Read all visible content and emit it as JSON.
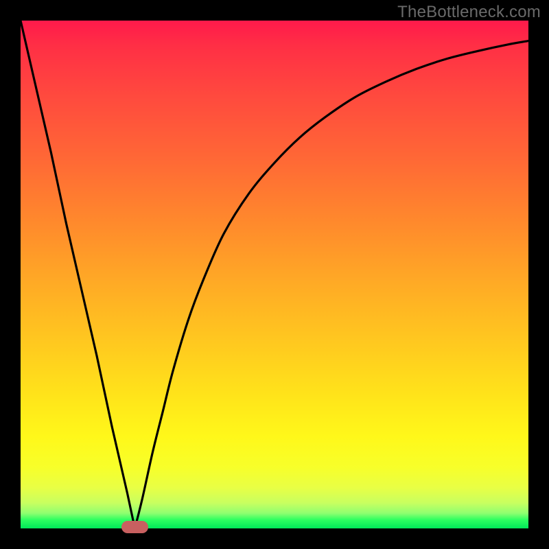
{
  "watermark": "TheBottleneck.com",
  "chart_data": {
    "type": "line",
    "title": "",
    "xlabel": "",
    "ylabel": "",
    "xlim": [
      0,
      100
    ],
    "ylim": [
      0,
      100
    ],
    "series": [
      {
        "name": "curve",
        "x": [
          0,
          3,
          6,
          9,
          12,
          15,
          18,
          21,
          22.5,
          24,
          26,
          28,
          30,
          33,
          36,
          40,
          45,
          50,
          55,
          60,
          66,
          72,
          78,
          84,
          90,
          96,
          100
        ],
        "values": [
          100,
          87,
          74,
          60,
          47,
          34,
          20,
          7,
          0,
          6,
          15,
          23,
          31,
          41,
          49,
          58,
          66,
          72,
          77,
          81,
          85,
          88,
          90.5,
          92.5,
          94,
          95.3,
          96
        ]
      }
    ],
    "marker": {
      "x": 22.5,
      "y": 0,
      "width_pct": 5.4,
      "height_pct": 2.4,
      "color": "#c86060"
    },
    "gradient_stops": [
      {
        "pos": 0,
        "color": "#ff1a4b"
      },
      {
        "pos": 50,
        "color": "#ffab25"
      },
      {
        "pos": 82,
        "color": "#fff81a"
      },
      {
        "pos": 100,
        "color": "#00e85a"
      }
    ]
  },
  "colors": {
    "frame": "#000000",
    "curve": "#000000",
    "watermark": "#6a6a6a"
  }
}
